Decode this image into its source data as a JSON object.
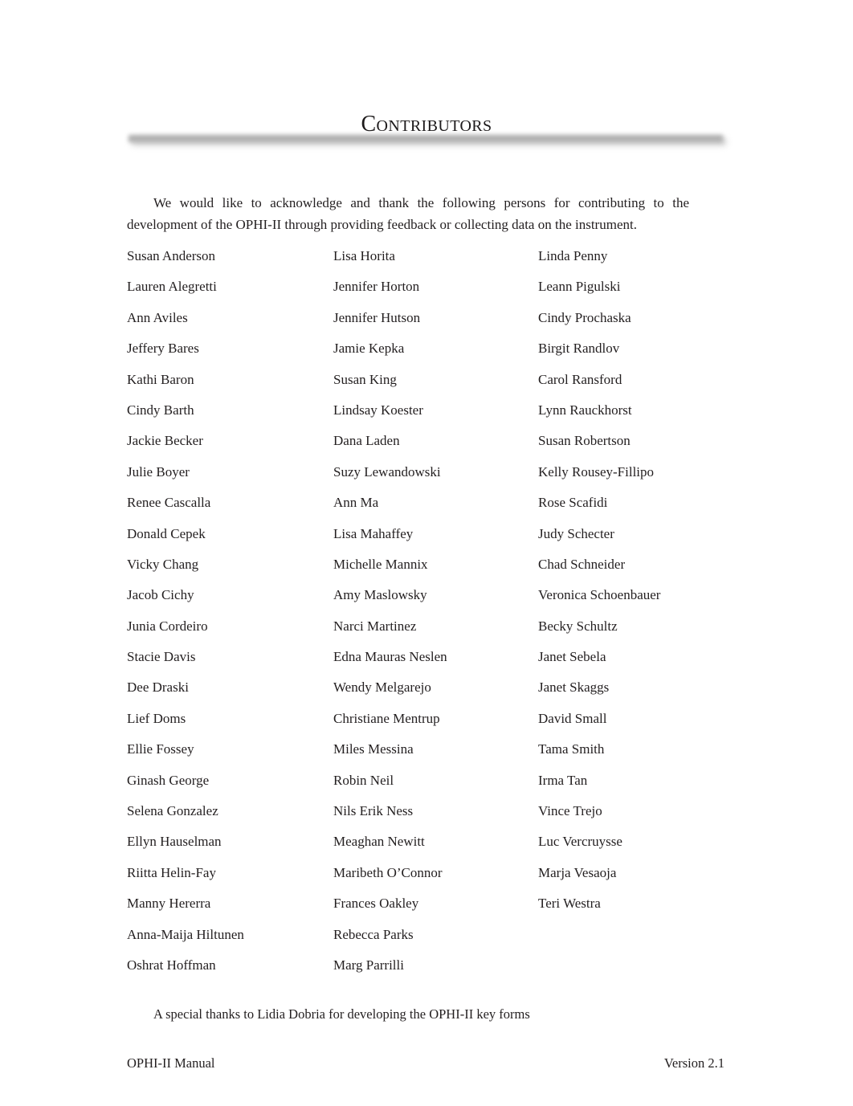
{
  "page": {
    "title": "Contributors",
    "intro": "We would like to acknowledge and thank the following persons for contributing to the development of the OPHI-II through providing feedback or collecting data on the instrument.",
    "special_thanks": "A special thanks to Lidia Dobria for developing the OPHI-II key forms"
  },
  "contributors": {
    "column1": [
      "Susan Anderson",
      "Lauren Alegretti",
      "Ann Aviles",
      "Jeffery Bares",
      "Kathi Baron",
      "Cindy Barth",
      "Jackie Becker",
      "Julie Boyer",
      "Renee Cascalla",
      "Donald Cepek",
      "Vicky Chang",
      "Jacob Cichy",
      "Junia Cordeiro",
      "Stacie Davis",
      "Dee Draski",
      "Lief Doms",
      "Ellie Fossey",
      "Ginash George",
      "Selena Gonzalez",
      "Ellyn Hauselman",
      "Riitta Helin-Fay",
      "Manny Hererra",
      "Anna-Maija Hiltunen",
      "Oshrat Hoffman"
    ],
    "column2": [
      "Lisa Horita",
      "Jennifer Horton",
      "Jennifer Hutson",
      "Jamie Kepka",
      "Susan King",
      "Lindsay Koester",
      "Dana Laden",
      "Suzy Lewandowski",
      "Ann Ma",
      "Lisa Mahaffey",
      "Michelle Mannix",
      "Amy Maslowsky",
      "Narci Martinez",
      "Edna Mauras Neslen",
      "Wendy Melgarejo",
      "Christiane Mentrup",
      "Miles Messina",
      "Robin Neil",
      "Nils Erik Ness",
      "Meaghan Newitt",
      "Maribeth O’Connor",
      "Frances Oakley",
      "Rebecca Parks",
      "Marg Parrilli"
    ],
    "column3": [
      "Linda Penny",
      "Leann Pigulski",
      "Cindy Prochaska",
      "Birgit Randlov",
      "Carol Ransford",
      "Lynn Rauckhorst",
      "Susan Robertson",
      "Kelly Rousey-Fillipo",
      "Rose Scafidi",
      "Judy Schecter",
      "Chad Schneider",
      "Veronica Schoenbauer",
      "Becky Schultz",
      "Janet Sebela",
      "Janet Skaggs",
      "David Small",
      "Tama Smith",
      "Irma Tan",
      "Vince Trejo",
      "Luc Vercruysse",
      "Marja Vesaoja",
      "Teri Westra"
    ]
  },
  "footer": {
    "left": "OPHI-II Manual",
    "right": "Version 2.1"
  }
}
